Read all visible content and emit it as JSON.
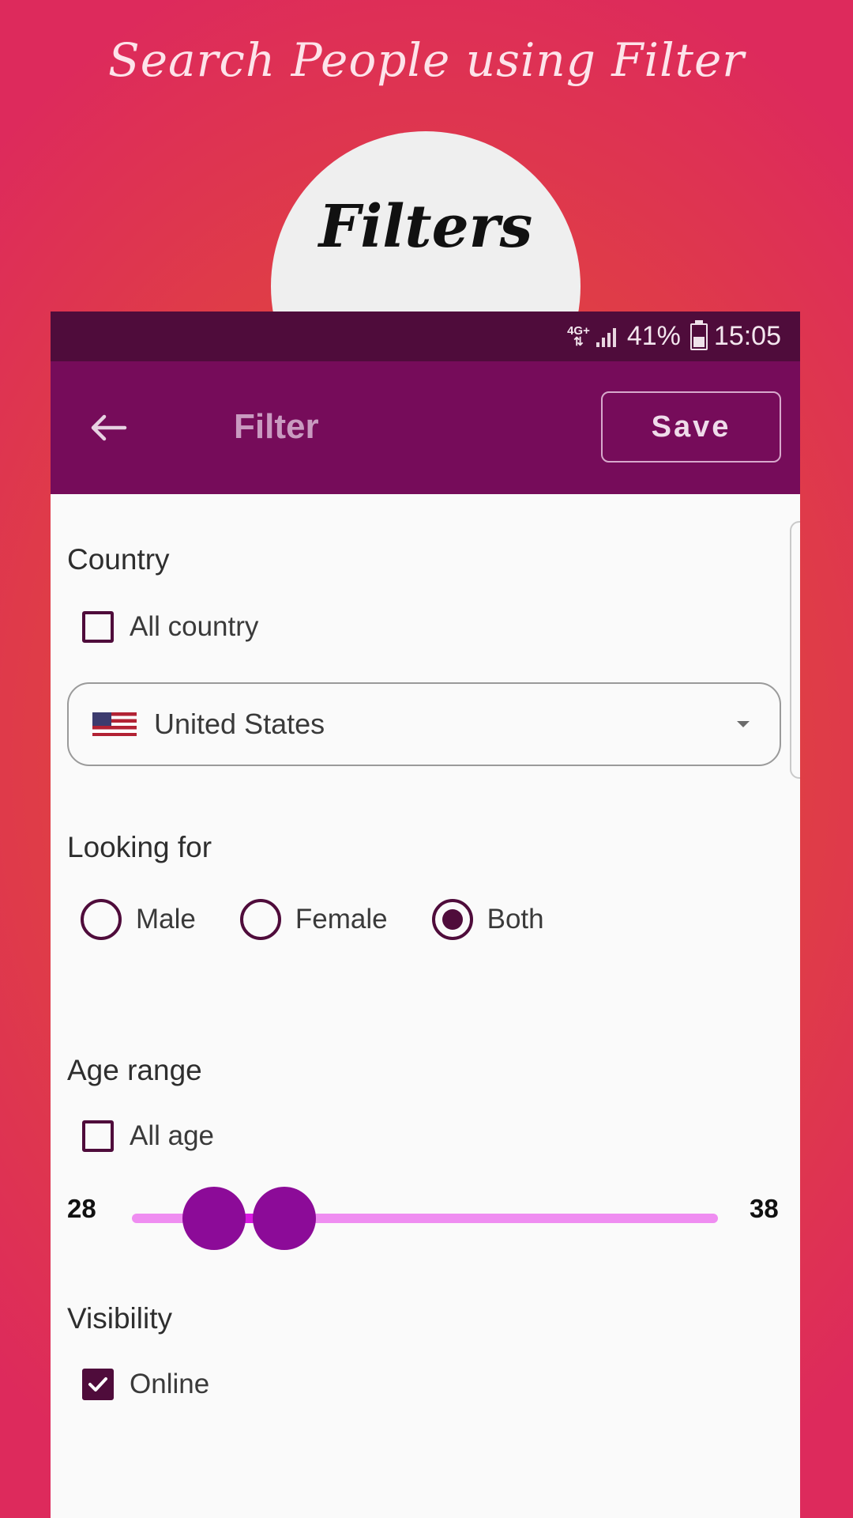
{
  "promo": {
    "headline": "Search People using Filter",
    "circle_label": "Filters"
  },
  "status_bar": {
    "network": "4G+",
    "battery": "41%",
    "time": "15:05"
  },
  "app_bar": {
    "back_icon": "arrow-left-icon",
    "title": "Filter",
    "save_label": "Save"
  },
  "country": {
    "title": "Country",
    "all_label": "All country",
    "all_checked": false,
    "selected": "United States",
    "flag_icon": "us-flag-icon"
  },
  "looking_for": {
    "title": "Looking for",
    "options": [
      "Male",
      "Female",
      "Both"
    ],
    "selected": "Both"
  },
  "age_range": {
    "title": "Age range",
    "all_label": "All age",
    "all_checked": false,
    "min_label": "28",
    "max_label": "38",
    "thumb_positions": [
      0.14,
      0.26
    ]
  },
  "visibility": {
    "title": "Visibility",
    "online_label": "Online",
    "online_checked": true
  },
  "colors": {
    "status_bar": "#4f0c3b",
    "app_bar": "#760c5a",
    "accent": "#8c0b98",
    "slider_track": "#ef8df1"
  }
}
